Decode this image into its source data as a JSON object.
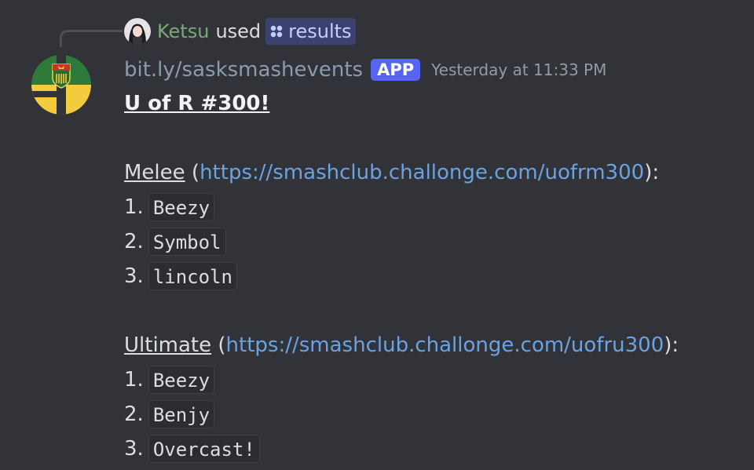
{
  "reply": {
    "username": "Ketsu",
    "verb": "used",
    "command": "results"
  },
  "message": {
    "bot_name": "bit.ly/sasksmashevents",
    "badge": "APP",
    "timestamp": "Yesterday at 11:33 PM",
    "title": "U of R #300!",
    "sections": [
      {
        "name": "Melee",
        "open": " (",
        "link": "https://smashclub.challonge.com/uofrm300",
        "close": "):",
        "placements": [
          {
            "rank": "1.",
            "player": "Beezy"
          },
          {
            "rank": "2.",
            "player": "Symbol"
          },
          {
            "rank": "3.",
            "player": "lincoln"
          }
        ]
      },
      {
        "name": "Ultimate",
        "open": " (",
        "link": "https://smashclub.challonge.com/uofru300",
        "close": "):",
        "placements": [
          {
            "rank": "1.",
            "player": "Beezy"
          },
          {
            "rank": "2.",
            "player": "Benjy"
          },
          {
            "rank": "3.",
            "player": "Overcast!"
          }
        ]
      }
    ]
  },
  "colors": {
    "background": "#313338",
    "username_green": "#7aa97a",
    "link_blue": "#6aa3e3",
    "badge_blurple": "#5865f2",
    "avatar_green": "#2f7a3a",
    "avatar_yellow": "#f2cc3d"
  },
  "icons": {
    "reply_avatar": "user-avatar-icon",
    "command": "slash-command-icon",
    "bot_avatar": "saskatchewan-flag-icon"
  }
}
